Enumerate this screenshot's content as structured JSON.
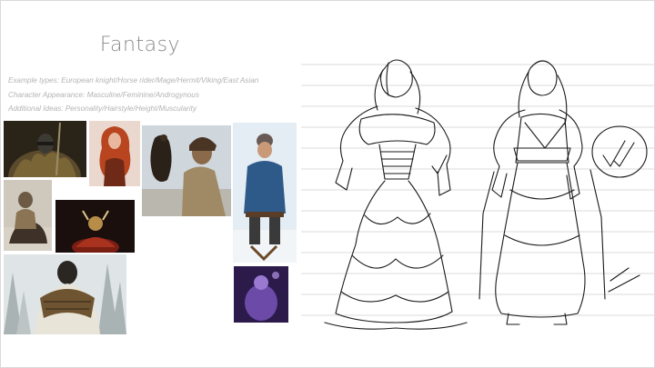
{
  "slide": {
    "title": "Fantasy",
    "notes": [
      "Example types: European knight/Horse rider/Mage/Hermit/Viking/East Asian",
      "Character Appearance: Masculine/Feminine/Androgynous",
      "Additional Ideas: Personality/Hairstyle/Height/Muscularity"
    ]
  },
  "colors": {
    "title": "#8a8a8a",
    "notes": "#b4b4b4",
    "ink": "#1a1a1a",
    "guide_lines": "#cccccc"
  },
  "reference_photos": [
    {
      "name": "helmeted-warrior-photo"
    },
    {
      "name": "red-haired-woman-photo"
    },
    {
      "name": "eagle-hunter-photo"
    },
    {
      "name": "winter-coat-man-photo"
    },
    {
      "name": "viking-rider-photo"
    },
    {
      "name": "horned-helmet-photo"
    },
    {
      "name": "snow-forest-cloak-photo"
    },
    {
      "name": "purple-figurine-photo"
    }
  ],
  "sketch": {
    "marks": [
      "check-mark-icon",
      "circled-check-icon"
    ]
  }
}
